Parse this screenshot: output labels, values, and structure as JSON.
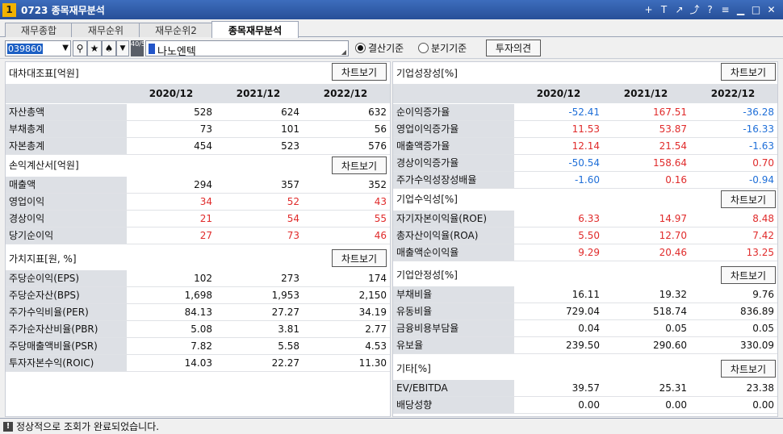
{
  "window": {
    "number": "1",
    "title": "0723 종목재무분석",
    "icons": [
      "plus-icon",
      "text-icon",
      "export-icon",
      "link-icon",
      "help-icon",
      "menu-icon",
      "minimize-icon",
      "maximize-icon",
      "close-icon"
    ]
  },
  "tabs": [
    {
      "label": "재무종합",
      "active": false
    },
    {
      "label": "재무순위",
      "active": false
    },
    {
      "label": "재무순위2",
      "active": false
    },
    {
      "label": "종목재무분석",
      "active": true
    }
  ],
  "toolbar": {
    "code": "039860",
    "stock_name": "나노엔텍",
    "toggle_label": "40/50",
    "radio_annual": "결산기준",
    "radio_quarter": "분기기준",
    "radio_selected": "annual",
    "invest_btn": "투자의견"
  },
  "chart_btn": "차트보기",
  "years": [
    "2020/12",
    "2021/12",
    "2022/12"
  ],
  "left": {
    "balance": {
      "title": "대차대조표[억원]",
      "rows": [
        {
          "label": "자산총액",
          "values": [
            "528",
            "624",
            "632"
          ]
        },
        {
          "label": "부채총계",
          "values": [
            "73",
            "101",
            "56"
          ]
        },
        {
          "label": "자본총계",
          "values": [
            "454",
            "523",
            "576"
          ]
        }
      ]
    },
    "income": {
      "title": "손익계산서[억원]",
      "rows": [
        {
          "label": "매출액",
          "values": [
            "294",
            "357",
            "352"
          ],
          "colored": false
        },
        {
          "label": "영업이익",
          "values": [
            "34",
            "52",
            "43"
          ],
          "colored": true
        },
        {
          "label": "경상이익",
          "values": [
            "21",
            "54",
            "55"
          ],
          "colored": true
        },
        {
          "label": "당기순이익",
          "values": [
            "27",
            "73",
            "46"
          ],
          "colored": true
        }
      ]
    },
    "value": {
      "title": "가치지표[원, %]",
      "rows": [
        {
          "label": "주당순이익(EPS)",
          "values": [
            "102",
            "273",
            "174"
          ]
        },
        {
          "label": "주당순자산(BPS)",
          "values": [
            "1,698",
            "1,953",
            "2,150"
          ]
        },
        {
          "label": "주가수익비율(PER)",
          "values": [
            "84.13",
            "27.27",
            "34.19"
          ]
        },
        {
          "label": "주가순자산비율(PBR)",
          "values": [
            "5.08",
            "3.81",
            "2.77"
          ]
        },
        {
          "label": "주당매출액비율(PSR)",
          "values": [
            "7.82",
            "5.58",
            "4.53"
          ]
        },
        {
          "label": "투자자본수익(ROIC)",
          "values": [
            "14.03",
            "22.27",
            "11.30"
          ]
        }
      ]
    }
  },
  "right": {
    "growth": {
      "title": "기업성장성[%]",
      "rows": [
        {
          "label": "순이익증가율",
          "values": [
            "-52.41",
            "167.51",
            "-36.28"
          ]
        },
        {
          "label": "영업이익증가율",
          "values": [
            "11.53",
            "53.87",
            "-16.33"
          ]
        },
        {
          "label": "매출액증가율",
          "values": [
            "12.14",
            "21.54",
            "-1.63"
          ]
        },
        {
          "label": "경상이익증가율",
          "values": [
            "-50.54",
            "158.64",
            "0.70"
          ]
        },
        {
          "label": "주가수익성장성배율",
          "values": [
            "-1.60",
            "0.16",
            "-0.94"
          ]
        }
      ]
    },
    "profit": {
      "title": "기업수익성[%]",
      "rows": [
        {
          "label": "자기자본이익율(ROE)",
          "values": [
            "6.33",
            "14.97",
            "8.48"
          ]
        },
        {
          "label": "총자산이익율(ROA)",
          "values": [
            "5.50",
            "12.70",
            "7.42"
          ]
        },
        {
          "label": "매출액순이익율",
          "values": [
            "9.29",
            "20.46",
            "13.25"
          ]
        }
      ]
    },
    "stability": {
      "title": "기업안정성[%]",
      "rows": [
        {
          "label": "부채비율",
          "values": [
            "16.11",
            "19.32",
            "9.76"
          ]
        },
        {
          "label": "유동비율",
          "values": [
            "729.04",
            "518.74",
            "836.89"
          ]
        },
        {
          "label": "금융비용부담율",
          "values": [
            "0.04",
            "0.05",
            "0.05"
          ]
        },
        {
          "label": "유보율",
          "values": [
            "239.50",
            "290.60",
            "330.09"
          ]
        }
      ]
    },
    "etc": {
      "title": "기타[%]",
      "rows": [
        {
          "label": "EV/EBITDA",
          "values": [
            "39.57",
            "25.31",
            "23.38"
          ]
        },
        {
          "label": "배당성향",
          "values": [
            "0.00",
            "0.00",
            "0.00"
          ]
        }
      ]
    }
  },
  "colors": {
    "positive": "#e02b2b",
    "negative": "#1f6fd8",
    "title_bar": "#274f98"
  },
  "status": "정상적으로 조회가 완료되었습니다."
}
